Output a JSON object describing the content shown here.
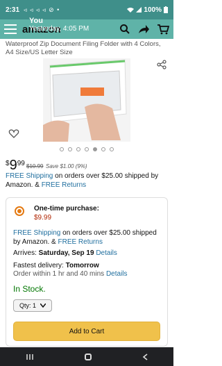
{
  "status_bar": {
    "time": "2:31",
    "notification_glyphs": "◃ ◃ ◃ ◃ ⊘ •",
    "battery": "100%"
  },
  "notification": {
    "sender": "You",
    "timestamp": "Yesterday, 4:05 PM"
  },
  "header": {
    "logo": "amazon"
  },
  "product": {
    "title": "Waterproof Zip Document Filing Folder with 4 Colors, A4 Size/US Letter Size",
    "image_count": 7,
    "active_image": 5,
    "price_symbol": "$",
    "price_whole": "9",
    "price_fraction": "99",
    "list_price": "$10.99",
    "savings": "Save $1.00 (9%)"
  },
  "shipping": {
    "free_shipping": "FREE Shipping",
    "text": " on orders over $25.00 shipped by Amazon. & ",
    "free_returns": "FREE Returns"
  },
  "purchase_box": {
    "option_label": "One-time purchase:",
    "option_price": "$9.99",
    "free_shipping": "FREE Shipping",
    "shipping_text": " on orders over $25.00 shipped by Amazon. & ",
    "free_returns": "FREE Returns",
    "arrives_label": "Arrives: ",
    "arrives_date": "Saturday, Sep 19",
    "details": "Details",
    "fastest_label": "Fastest delivery: ",
    "fastest_day": "Tomorrow",
    "fastest_window": "Order within 1 hr and 40 mins",
    "fastest_details": "Details",
    "stock": "In Stock.",
    "qty": "Qty: 1",
    "add_to_cart": "Add to Cart"
  },
  "colors": {
    "status_bar": "#3f8f8a",
    "header": "#5fb3a8",
    "link": "#1f6e9e",
    "price_red": "#b12704",
    "stock_green": "#007600",
    "cart_button": "#f0c14b",
    "radio": "#e47911"
  },
  "icons": [
    "menu-icon",
    "search-icon",
    "share-icon",
    "cart-icon",
    "heart-icon",
    "back-icon",
    "home-icon",
    "recents-icon"
  ]
}
